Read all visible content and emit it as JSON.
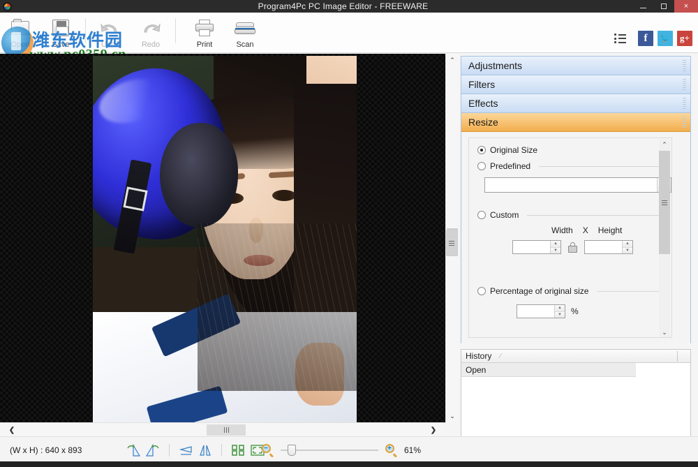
{
  "window": {
    "title": "Program4Pc PC Image Editor - FREEWARE",
    "app_icon": "app-logo-icon",
    "minimize": "–",
    "maximize": "□",
    "close": "×"
  },
  "toolbar": {
    "buttons": [
      {
        "label": "Open",
        "icon": "folder-open-icon",
        "enabled": true
      },
      {
        "label": "Save",
        "icon": "floppy-disk-icon",
        "enabled": true
      },
      {
        "label": "Undo",
        "icon": "undo-arrow-icon",
        "enabled": false
      },
      {
        "label": "Redo",
        "icon": "redo-arrow-icon",
        "enabled": false
      },
      {
        "label": "Print",
        "icon": "printer-icon",
        "enabled": true
      },
      {
        "label": "Scan",
        "icon": "scanner-icon",
        "enabled": true
      }
    ],
    "right_icons": [
      {
        "name": "list-menu-icon",
        "label": ""
      },
      {
        "name": "facebook-icon",
        "label": "f",
        "color": "#3b5998"
      },
      {
        "name": "twitter-icon",
        "label": "t",
        "color": "#41b3e0"
      },
      {
        "name": "google-plus-icon",
        "label": "g+",
        "color": "#c9443b"
      }
    ]
  },
  "watermark": {
    "chinese_text": "潍东软件园",
    "url_text": "www.pc0359.cn"
  },
  "panels": {
    "accordion": [
      {
        "label": "Adjustments",
        "active": false
      },
      {
        "label": "Filters",
        "active": false
      },
      {
        "label": "Effects",
        "active": false
      },
      {
        "label": "Resize",
        "active": true
      }
    ]
  },
  "resize": {
    "original_size": {
      "label": "Original Size",
      "selected": true
    },
    "predefined": {
      "label": "Predefined",
      "selected": false
    },
    "predefined_combo": {
      "value": "",
      "placeholder": ""
    },
    "custom": {
      "label": "Custom",
      "selected": false
    },
    "width_label": "Width",
    "x_label": "X",
    "height_label": "Height",
    "width_value": "",
    "height_value": "",
    "lock_icon": "aspect-ratio-lock-icon",
    "percentage": {
      "label": "Percentage of original size",
      "selected": false
    },
    "percent_value": "",
    "percent_sign": "%"
  },
  "history": {
    "header": "History",
    "sort_mark": "⁄",
    "items": [
      {
        "label": "Open"
      }
    ]
  },
  "statusbar": {
    "dimensions": "(W x H) : 640 x 893",
    "tools": [
      {
        "name": "rotate-right-icon"
      },
      {
        "name": "rotate-left-icon"
      },
      {
        "name": "flip-vertical-icon"
      },
      {
        "name": "flip-horizontal-icon"
      },
      {
        "name": "crop-icon"
      },
      {
        "name": "fit-to-screen-icon"
      }
    ],
    "zoom_out_icon": "zoom-out-icon",
    "zoom_in_icon": "zoom-in-icon",
    "zoom_level": "61%",
    "zoom_out_sign": "−",
    "zoom_in_sign": "+"
  },
  "canvas": {
    "scroll_up": "⌃",
    "scroll_down": "⌄",
    "scroll_left": "❮",
    "scroll_right": "❯"
  },
  "colors": {
    "accent_active": "#f3ae4e",
    "panel_header": "#c9dcf4",
    "titlebar": "#2b2b2b",
    "close_button": "#c4504f"
  }
}
